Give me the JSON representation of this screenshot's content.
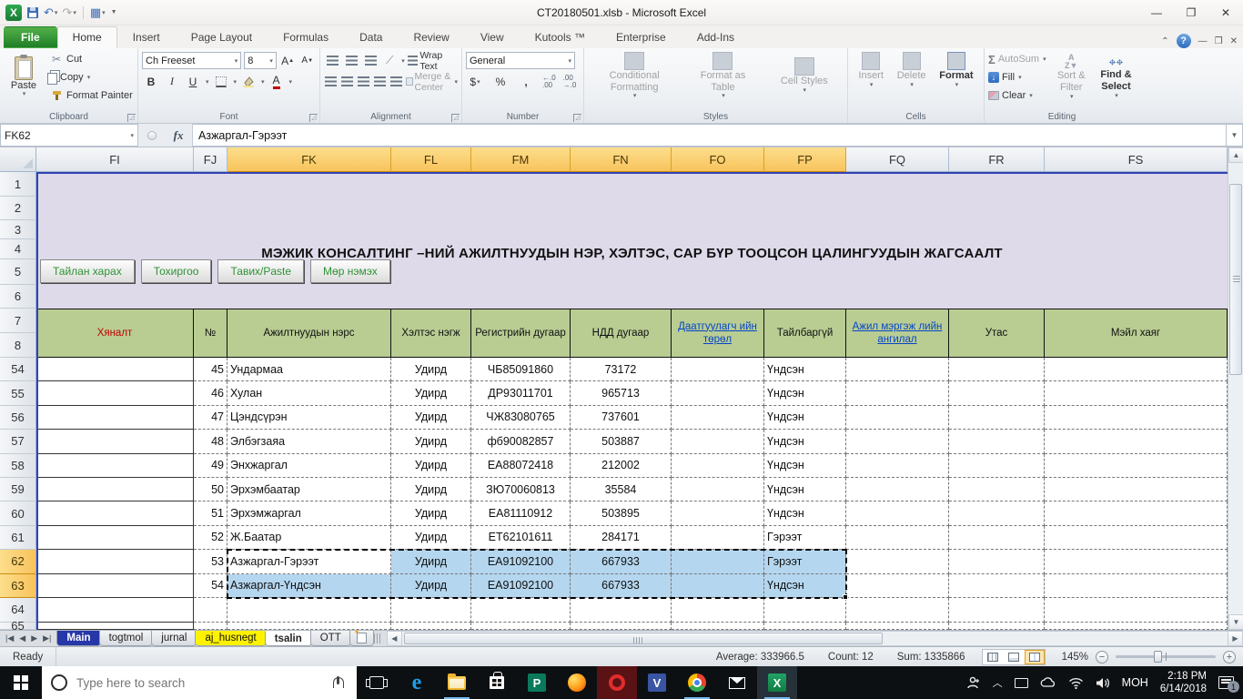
{
  "window": {
    "title": "CT20180501.xlsb - Microsoft Excel"
  },
  "ribbon": {
    "tabs": [
      "File",
      "Home",
      "Insert",
      "Page Layout",
      "Formulas",
      "Data",
      "Review",
      "View",
      "Kutools ™",
      "Enterprise",
      "Add-Ins"
    ],
    "active_tab": "Home",
    "clipboard": {
      "paste": "Paste",
      "cut": "Cut",
      "copy": "Copy",
      "format_painter": "Format Painter",
      "label": "Clipboard"
    },
    "font": {
      "family": "Ch Freeset",
      "size": "8",
      "bold": "B",
      "italic": "I",
      "underline": "U",
      "label": "Font"
    },
    "alignment": {
      "wrap": "Wrap Text",
      "merge": "Merge & Center",
      "label": "Alignment"
    },
    "number": {
      "format": "General",
      "currency": "$",
      "percent": "%",
      "comma": ",",
      "label": "Number"
    },
    "styles": {
      "conditional": "Conditional Formatting",
      "format_table": "Format as Table",
      "cell_styles": "Cell Styles",
      "label": "Styles"
    },
    "cells": {
      "insert": "Insert",
      "delete": "Delete",
      "format": "Format",
      "label": "Cells"
    },
    "editing": {
      "autosum": "AutoSum",
      "fill": "Fill",
      "clear": "Clear",
      "sort": "Sort & Filter",
      "find": "Find & Select",
      "label": "Editing"
    }
  },
  "formula_bar": {
    "name_box": "FK62",
    "fx": "fx",
    "value": "Азжаргал-Гэрээт"
  },
  "sheet": {
    "columns": [
      "FI",
      "FJ",
      "FK",
      "FL",
      "FM",
      "FN",
      "FO",
      "FP",
      "FQ",
      "FR",
      "FS"
    ],
    "selected_columns": [
      "FK",
      "FL",
      "FM",
      "FN",
      "FO",
      "FP"
    ],
    "row_numbers": [
      "1",
      "2",
      "3",
      "4",
      "5",
      "6",
      "7",
      "8",
      "54",
      "55",
      "56",
      "57",
      "58",
      "59",
      "60",
      "61",
      "62",
      "63",
      "64",
      "65"
    ],
    "selected_rows": [
      "62",
      "63"
    ],
    "title": "МЭЖИК КОНСАЛТИНГ –НИЙ АЖИЛТНУУДЫН НЭР, ХЭЛТЭС, САР БҮР ТООЦСОН ЦАЛИНГУУДЫН ЖАГСААЛТ",
    "buttons": [
      "Тайлан харах",
      "Тохиргоо",
      "Тавих/Paste",
      "Мөр нэмэх"
    ],
    "table_headers": {
      "FI": "Хяналт",
      "FJ": "№",
      "FK": "Ажилтнуудын нэрс",
      "FL": "Хэлтэс нэгж",
      "FM": "Регистрийн дугаар",
      "FN": "НДД дугаар",
      "FO": "Даатгуулагч ийн төрөл",
      "FP": "Тайлбаргүй",
      "FQ": "Ажил мэргэж лийн ангилал",
      "FR": "Утас",
      "FS": "Мэйл хаяг"
    },
    "rows": [
      {
        "n": "54",
        "no": "45",
        "name": "Ундармаа",
        "dept": "Удирд",
        "reg": "ЧБ85091860",
        "ndd": "73172",
        "type": "Үндсэн"
      },
      {
        "n": "55",
        "no": "46",
        "name": "Хулан",
        "dept": "Удирд",
        "reg": "ДР93011701",
        "ndd": "965713",
        "type": "Үндсэн"
      },
      {
        "n": "56",
        "no": "47",
        "name": "Цэндсүрэн",
        "dept": "Удирд",
        "reg": "ЧЖ83080765",
        "ndd": "737601",
        "type": "Үндсэн"
      },
      {
        "n": "57",
        "no": "48",
        "name": "Элбэгзаяа",
        "dept": "Удирд",
        "reg": "фб90082857",
        "ndd": "503887",
        "type": "Үндсэн"
      },
      {
        "n": "58",
        "no": "49",
        "name": "Энхжаргал",
        "dept": "Удирд",
        "reg": "ЕА88072418",
        "ndd": "212002",
        "type": "Үндсэн"
      },
      {
        "n": "59",
        "no": "50",
        "name": "Эрхэмбаатар",
        "dept": "Удирд",
        "reg": "ЗЮ70060813",
        "ndd": "35584",
        "type": "Үндсэн"
      },
      {
        "n": "60",
        "no": "51",
        "name": "Эрхэмжаргал",
        "dept": "Удирд",
        "reg": "ЕА81110912",
        "ndd": "503895",
        "type": "Үндсэн"
      },
      {
        "n": "61",
        "no": "52",
        "name": "Ж.Баатар",
        "dept": "Удирд",
        "reg": "ЕТ62101611",
        "ndd": "284171",
        "type": "Гэрээт"
      },
      {
        "n": "62",
        "no": "53",
        "name": "Азжаргал-Гэрээт",
        "dept": "Удирд",
        "reg": "ЕА91092100",
        "ndd": "667933",
        "type": "Гэрээт",
        "selected": true,
        "active": true
      },
      {
        "n": "63",
        "no": "54",
        "name": "Азжаргал-Үндсэн",
        "dept": "Удирд",
        "reg": "ЕА91092100",
        "ndd": "667933",
        "type": "Үндсэн",
        "selected": true
      }
    ],
    "selection": {
      "range": "FK62:FP63",
      "active_cell": "FK62"
    }
  },
  "sheet_tabs": [
    {
      "label": "Main",
      "style": "main"
    },
    {
      "label": "togtmol",
      "style": ""
    },
    {
      "label": "jurnal",
      "style": ""
    },
    {
      "label": "aj_husnegt",
      "style": "yellow"
    },
    {
      "label": "tsalin",
      "style": "active"
    },
    {
      "label": "OTT",
      "style": ""
    }
  ],
  "status_bar": {
    "mode": "Ready",
    "average": "Average: 333966.5",
    "count": "Count: 12",
    "sum": "Sum: 1335866",
    "zoom": "145%"
  },
  "taskbar": {
    "search_placeholder": "Type here to search",
    "language": "MOH",
    "time": "2:18 PM",
    "date": "6/14/2018",
    "notification_count": "1"
  }
}
